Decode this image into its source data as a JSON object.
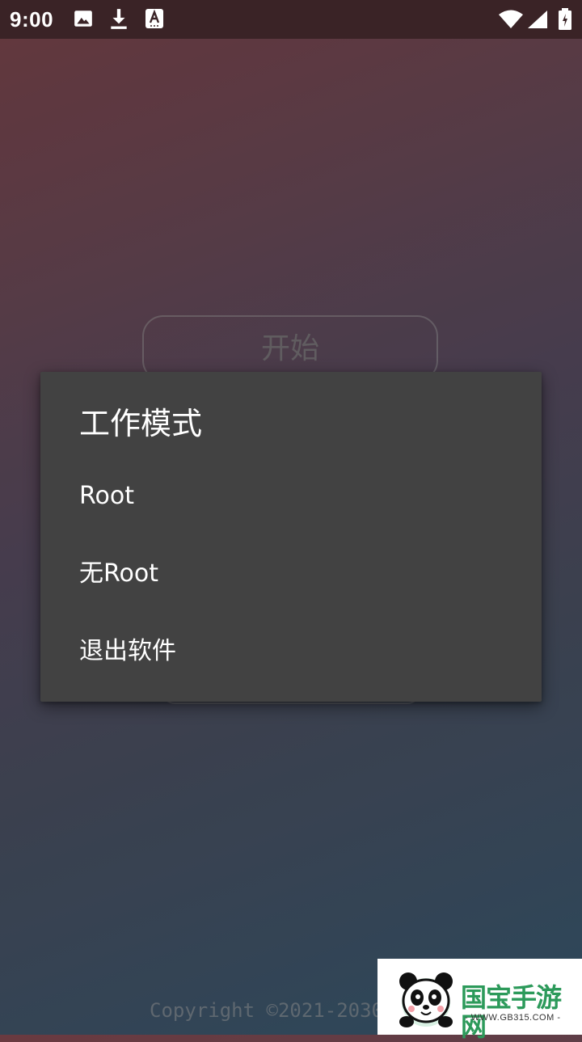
{
  "status_bar": {
    "time": "9:00",
    "left_icons": [
      "image-icon",
      "download-icon",
      "accessibility-a-icon"
    ],
    "right_icons": [
      "wifi-icon",
      "signal-icon",
      "battery-icon"
    ]
  },
  "main": {
    "start_label": "开始",
    "copyright": "Copyright ©2021-2030"
  },
  "dialog": {
    "title": "工作模式",
    "items": [
      {
        "label": "Root"
      },
      {
        "label": "无Root"
      },
      {
        "label": "退出软件"
      }
    ]
  },
  "watermark": {
    "name": "国宝手游网",
    "url": "- WWW.GB315.COM -"
  },
  "colors": {
    "dialog_background": "#424242",
    "status_bar": "#3a2326",
    "watermark_green": "#2c9a5a"
  }
}
